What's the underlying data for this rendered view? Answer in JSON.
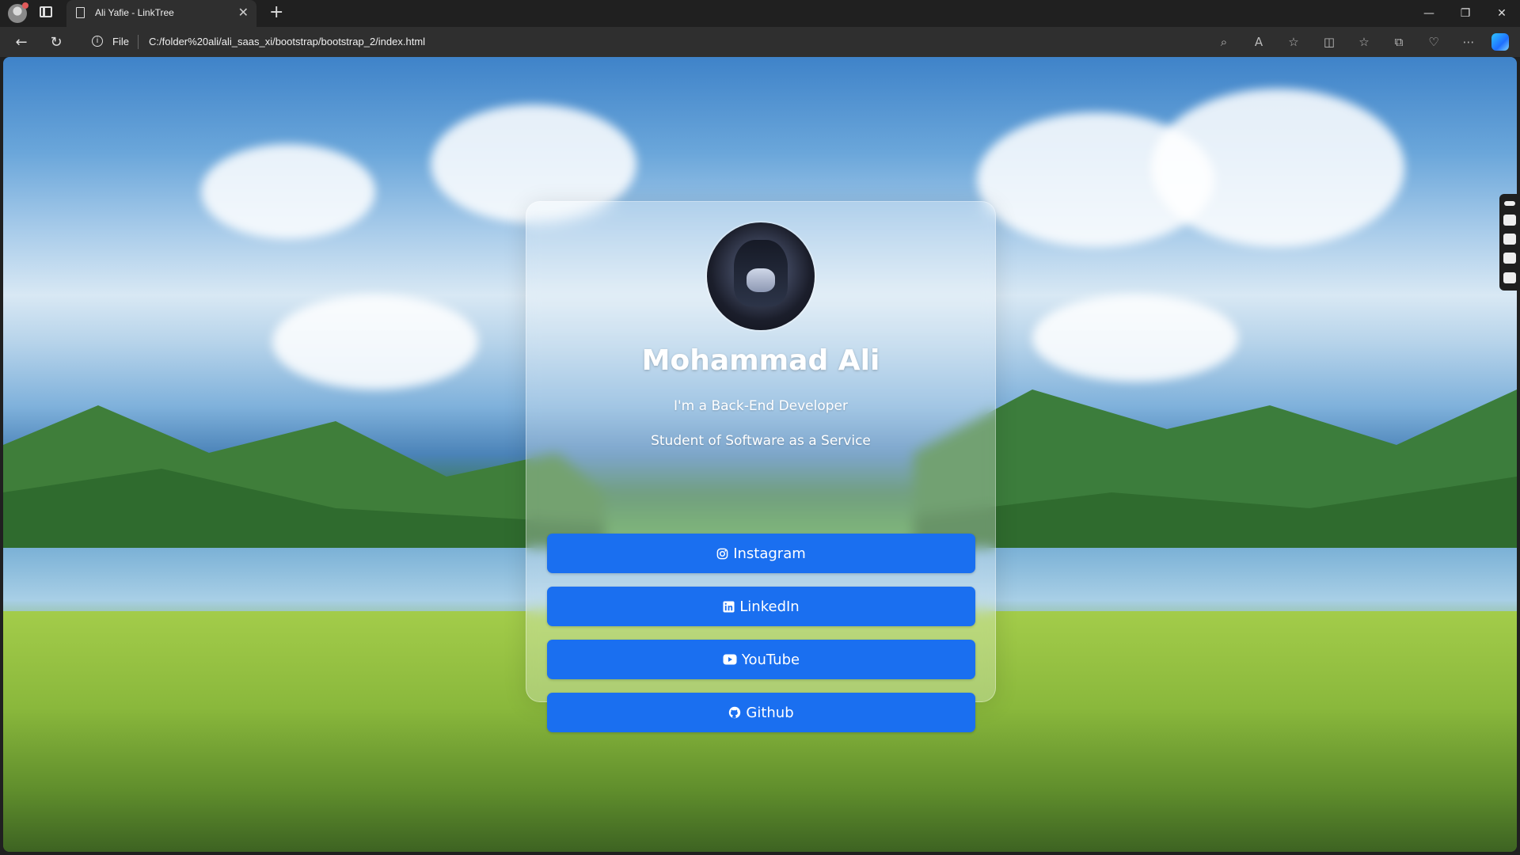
{
  "browser": {
    "tab_title": "Ali Yafie - LinkTree",
    "tab_close": "✕",
    "new_tab": "+",
    "window_controls": [
      "—",
      "❐",
      "✕"
    ],
    "address": {
      "protocol_label": "File",
      "url": "C:/folder%20ali/ali_saas_xi/bootstrap/bootstrap_2/index.html"
    },
    "toolbar_icons": [
      "zoom-icon",
      "read-aloud-icon",
      "favorite-star-icon",
      "split-screen-icon",
      "favorites-icon",
      "collections-icon",
      "browser-essentials-icon",
      "more-icon"
    ]
  },
  "profile": {
    "name": "Mohammad Ali",
    "tagline_1": "I'm a Back-End Developer",
    "tagline_2": "Student of Software as a Service"
  },
  "links": [
    {
      "label": "Instagram",
      "icon": "instagram-icon"
    },
    {
      "label": "LinkedIn",
      "icon": "linkedin-icon"
    },
    {
      "label": "YouTube",
      "icon": "youtube-icon"
    },
    {
      "label": "Github",
      "icon": "github-icon"
    }
  ],
  "colors": {
    "button_bg": "#1a6ff0",
    "text": "#ffffff"
  }
}
